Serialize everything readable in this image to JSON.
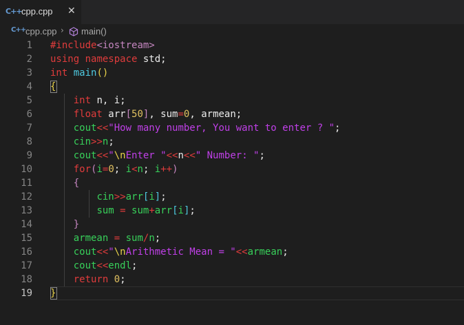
{
  "tab": {
    "icon": "C++",
    "filename": "cpp.cpp",
    "close": "✕"
  },
  "breadcrumb": {
    "icon": "C++",
    "file": "cpp.cpp",
    "separator": "›",
    "symbol": "main()"
  },
  "editor": {
    "active_line": "19",
    "line_numbers": [
      "1",
      "2",
      "3",
      "4",
      "5",
      "6",
      "7",
      "8",
      "9",
      "10",
      "11",
      "12",
      "13",
      "14",
      "15",
      "16",
      "17",
      "18",
      "19"
    ],
    "lines": [
      [
        [
          "t-red",
          "#include"
        ],
        [
          "t-pre",
          "<iostream>"
        ]
      ],
      [
        [
          "t-red",
          "using"
        ],
        [
          "t-wht",
          " "
        ],
        [
          "t-red",
          "namespace"
        ],
        [
          "t-wht",
          " std;"
        ]
      ],
      [
        [
          "t-red",
          "int"
        ],
        [
          "t-wht",
          " "
        ],
        [
          "t-cyan",
          "main"
        ],
        [
          "t-yel",
          "()"
        ]
      ],
      [
        [
          "t-yel",
          "{"
        ]
      ],
      [
        [
          "t-wht",
          "    "
        ],
        [
          "t-red",
          "int"
        ],
        [
          "t-wht",
          " n, i;"
        ]
      ],
      [
        [
          "t-wht",
          "    "
        ],
        [
          "t-red",
          "float"
        ],
        [
          "t-wht",
          " arr"
        ],
        [
          "t-pre",
          "["
        ],
        [
          "t-num",
          "50"
        ],
        [
          "t-pre",
          "]"
        ],
        [
          "t-wht",
          ", sum"
        ],
        [
          "t-red",
          "="
        ],
        [
          "t-num",
          "0"
        ],
        [
          "t-wht",
          ", armean;"
        ]
      ],
      [
        [
          "t-wht",
          "    "
        ],
        [
          "t-grn",
          "cout"
        ],
        [
          "t-red",
          "<<"
        ],
        [
          "t-purple",
          "\"How many number, You want to enter ? \""
        ],
        [
          "t-wht",
          ";"
        ]
      ],
      [
        [
          "t-wht",
          "    "
        ],
        [
          "t-grn",
          "cin"
        ],
        [
          "t-red",
          ">>"
        ],
        [
          "t-grn",
          "n"
        ],
        [
          "t-wht",
          ";"
        ]
      ],
      [
        [
          "t-wht",
          "    "
        ],
        [
          "t-grn",
          "cout"
        ],
        [
          "t-red",
          "<<"
        ],
        [
          "t-purple",
          "\""
        ],
        [
          "t-yel",
          "\\n"
        ],
        [
          "t-purple",
          "Enter \""
        ],
        [
          "t-red",
          "<<"
        ],
        [
          "t-wht",
          "n"
        ],
        [
          "t-red",
          "<<"
        ],
        [
          "t-purple",
          "\" Number: \""
        ],
        [
          "t-wht",
          ";"
        ]
      ],
      [
        [
          "t-wht",
          "    "
        ],
        [
          "t-red",
          "for"
        ],
        [
          "t-pre",
          "("
        ],
        [
          "t-grn",
          "i"
        ],
        [
          "t-red",
          "="
        ],
        [
          "t-num",
          "0"
        ],
        [
          "t-wht",
          "; "
        ],
        [
          "t-grn",
          "i"
        ],
        [
          "t-red",
          "<"
        ],
        [
          "t-grn",
          "n"
        ],
        [
          "t-wht",
          "; "
        ],
        [
          "t-grn",
          "i"
        ],
        [
          "t-red",
          "++"
        ],
        [
          "t-pre",
          ")"
        ]
      ],
      [
        [
          "t-wht",
          "    "
        ],
        [
          "t-pre",
          "{"
        ]
      ],
      [
        [
          "t-wht",
          "        "
        ],
        [
          "t-grn",
          "cin"
        ],
        [
          "t-red",
          ">>"
        ],
        [
          "t-grn",
          "arr"
        ],
        [
          "t-cyan",
          "["
        ],
        [
          "t-grn",
          "i"
        ],
        [
          "t-cyan",
          "]"
        ],
        [
          "t-wht",
          ";"
        ]
      ],
      [
        [
          "t-wht",
          "        "
        ],
        [
          "t-grn",
          "sum"
        ],
        [
          "t-wht",
          " "
        ],
        [
          "t-red",
          "="
        ],
        [
          "t-wht",
          " "
        ],
        [
          "t-grn",
          "sum"
        ],
        [
          "t-red",
          "+"
        ],
        [
          "t-grn",
          "arr"
        ],
        [
          "t-cyan",
          "["
        ],
        [
          "t-grn",
          "i"
        ],
        [
          "t-cyan",
          "]"
        ],
        [
          "t-wht",
          ";"
        ]
      ],
      [
        [
          "t-wht",
          "    "
        ],
        [
          "t-pre",
          "}"
        ]
      ],
      [
        [
          "t-wht",
          "    "
        ],
        [
          "t-grn",
          "armean"
        ],
        [
          "t-wht",
          " "
        ],
        [
          "t-red",
          "="
        ],
        [
          "t-wht",
          " "
        ],
        [
          "t-grn",
          "sum"
        ],
        [
          "t-red",
          "/"
        ],
        [
          "t-grn",
          "n"
        ],
        [
          "t-wht",
          ";"
        ]
      ],
      [
        [
          "t-wht",
          "    "
        ],
        [
          "t-grn",
          "cout"
        ],
        [
          "t-red",
          "<<"
        ],
        [
          "t-purple",
          "\""
        ],
        [
          "t-yel",
          "\\n"
        ],
        [
          "t-purple",
          "Arithmetic Mean = \""
        ],
        [
          "t-red",
          "<<"
        ],
        [
          "t-grn",
          "armean"
        ],
        [
          "t-wht",
          ";"
        ]
      ],
      [
        [
          "t-wht",
          "    "
        ],
        [
          "t-grn",
          "cout"
        ],
        [
          "t-red",
          "<<"
        ],
        [
          "t-grn",
          "endl"
        ],
        [
          "t-wht",
          ";"
        ]
      ],
      [
        [
          "t-wht",
          "    "
        ],
        [
          "t-red",
          "return"
        ],
        [
          "t-wht",
          " "
        ],
        [
          "t-num",
          "0"
        ],
        [
          "t-wht",
          ";"
        ]
      ],
      [
        [
          "t-yel",
          "}"
        ]
      ]
    ]
  }
}
